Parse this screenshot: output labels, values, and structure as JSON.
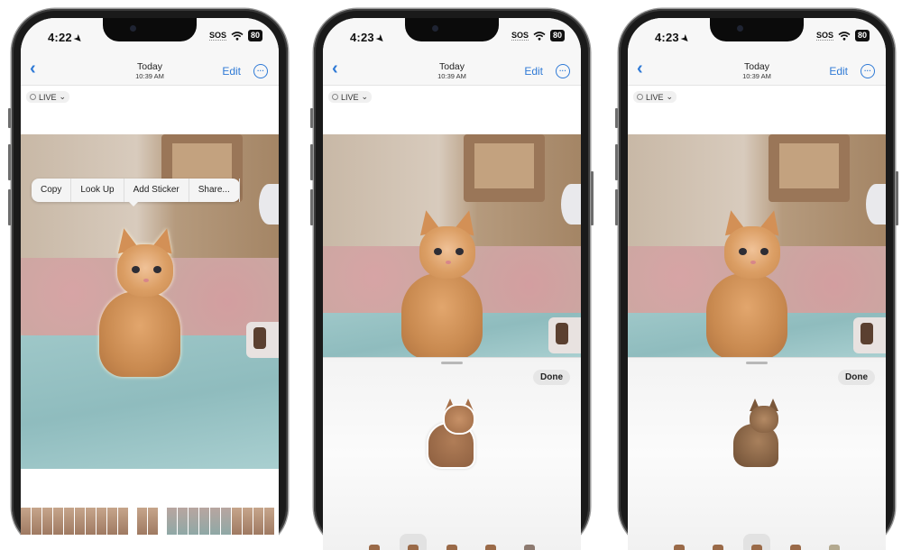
{
  "phones": [
    {
      "status": {
        "time": "4:22",
        "sos": "SOS",
        "battery": "80"
      },
      "nav": {
        "back": "‹",
        "title": "Today",
        "subtitle": "10:39 AM",
        "edit": "Edit",
        "more": "···"
      },
      "live_label": "LIVE",
      "context_menu": [
        "Copy",
        "Look Up",
        "Add Sticker",
        "Share..."
      ]
    },
    {
      "status": {
        "time": "4:23",
        "sos": "SOS",
        "battery": "80"
      },
      "nav": {
        "back": "‹",
        "title": "Today",
        "subtitle": "10:39 AM",
        "edit": "Edit",
        "more": "···"
      },
      "live_label": "LIVE",
      "sheet": {
        "done": "Done",
        "selected_effect_index": 1,
        "sticker_style": "original"
      }
    },
    {
      "status": {
        "time": "4:23",
        "sos": "SOS",
        "battery": "80"
      },
      "nav": {
        "back": "‹",
        "title": "Today",
        "subtitle": "10:39 AM",
        "edit": "Edit",
        "more": "···"
      },
      "live_label": "LIVE",
      "sheet": {
        "done": "Done",
        "selected_effect_index": 2,
        "sticker_style": "comic"
      }
    }
  ],
  "icons": {
    "location": "➤",
    "live": "live-photo-icon",
    "chevron": "⌄"
  },
  "colors": {
    "accent": "#2f7ad6"
  }
}
